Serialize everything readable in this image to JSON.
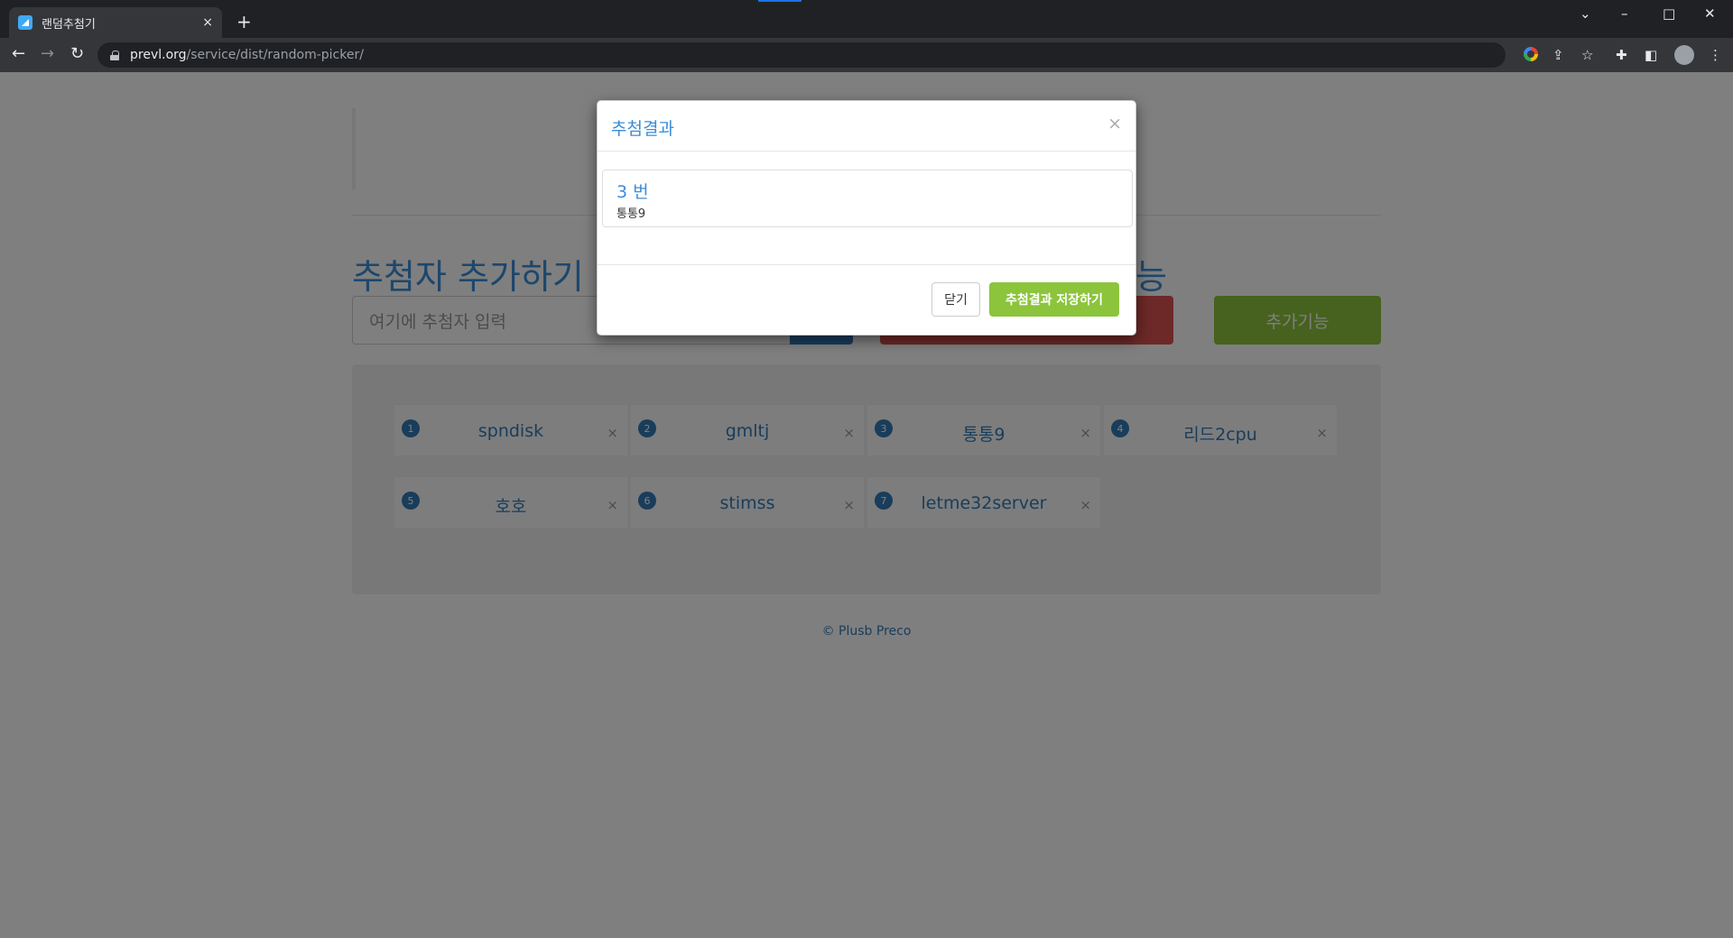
{
  "browser": {
    "tab_title": "랜덤추첨기",
    "tab_close": "×",
    "new_tab": "+",
    "url_host": "prevl.org",
    "url_path": "/service/dist/random-picker/",
    "window_controls": {
      "chevron": "⌄",
      "minimize": "–",
      "maximize": "□",
      "close": "✕"
    }
  },
  "page": {
    "section_title_left": "추첨자 추가하기",
    "section_title_right": "능",
    "input_placeholder": "여기에 추첨자 입력",
    "extra_button": "추가기능",
    "entries": [
      {
        "num": "1",
        "name": "spndisk"
      },
      {
        "num": "2",
        "name": "gmltj"
      },
      {
        "num": "3",
        "name": "통통9"
      },
      {
        "num": "4",
        "name": "리드2cpu"
      },
      {
        "num": "5",
        "name": "호호"
      },
      {
        "num": "6",
        "name": "stimss"
      },
      {
        "num": "7",
        "name": "letme32server"
      }
    ],
    "entry_remove": "×",
    "footer": "© Plusb Preco"
  },
  "modal": {
    "title": "추첨결과",
    "close_x": "×",
    "result_number": "3 번",
    "result_name": "통통9",
    "close_button": "닫기",
    "save_button": "추첨결과 저장하기"
  },
  "colors": {
    "accent_blue": "#337ab7",
    "accent_green": "#8cc43c",
    "accent_red": "#d9534f"
  }
}
